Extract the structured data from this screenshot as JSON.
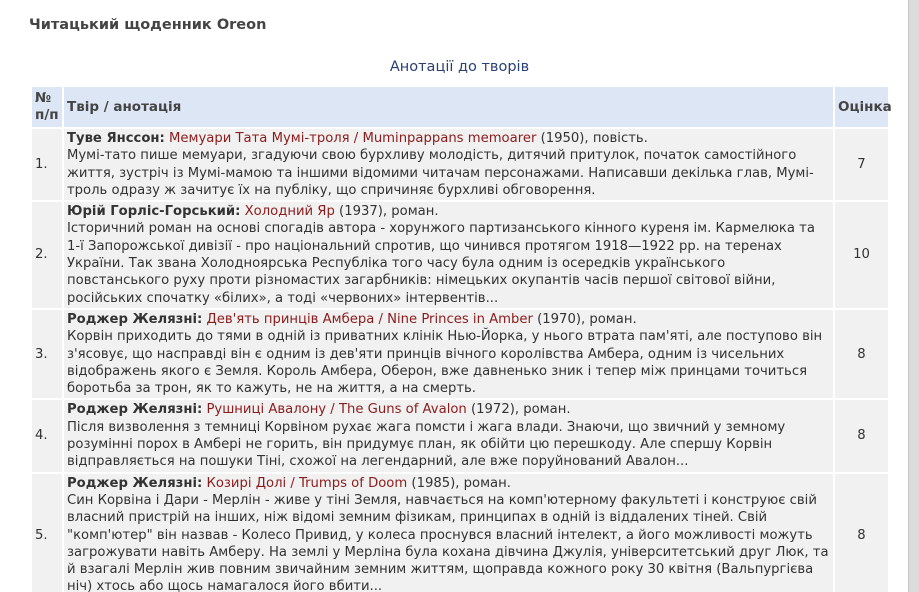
{
  "page_title": "Читацький щоденник Oreon",
  "table_caption": "Анотації до творів",
  "columns": {
    "number": "№ п/п",
    "work": "Твір / анотація",
    "score": "Оцінка"
  },
  "rows": [
    {
      "num": "1.",
      "author": "Туве Янссон:",
      "title": "Мемуари Тата Мумі-троля / Muminpappans memoarer",
      "meta": "(1950), повість.",
      "annotation": "Мумі-тато пише мемуари, згадуючи свою бурхливу молодість, дитячий притулок, початок самостійного життя, зустріч із Мумі-мамою та іншими відомими читачам персонажами. Написавши декілька глав, Мумі-троль одразу ж зачитує їх на публіку, що спричиняє бурхливі обговорення.",
      "score": "7"
    },
    {
      "num": "2.",
      "author": "Юрій Горліс-Горський:",
      "title": "Холодний Яр",
      "meta": "(1937), роман.",
      "annotation": "Історичний роман на основі спогадів автора - хорунжого партизанського кінного куреня ім. Кармелюка та 1-ї Запорожської дивізії - про національний спротив, що чинився протягом 1918—1922 рр. на теренах України. Так звана Холодноярська Республіка того часу була одним із осередків українського повстанського руху проти різномастих загарбників: німецьких окупантів часів першої світової війни, російських спочатку «білих», а тоді «червоних» інтервентів...",
      "score": "10"
    },
    {
      "num": "3.",
      "author": "Роджер Желязні:",
      "title": "Дев'ять принців Амбера / Nine Princes in Amber",
      "meta": "(1970), роман.",
      "annotation": "Корвін приходить до тями в одній із приватних клінік Нью-Йорка, у нього втрата пам'яті, але поступово він з'ясовує, що насправді він є одним із дев'яти принців вічного королівства Амбера, одним із чисельних відображень якого є Земля. Король Амбера, Оберон, вже давненько зник і тепер між принцами точиться боротьба за трон, як то кажуть, не на життя, а на смерть.",
      "score": "8"
    },
    {
      "num": "4.",
      "author": "Роджер Желязні:",
      "title": "Рушниці Авалону / The Guns of Avalon",
      "meta": "(1972), роман.",
      "annotation": "Після визволення з темниці Корвіном рухає жага помсти і жага влади. Знаючи, що звичний у земному розумінні порох в Амбері не горить, він придумує план, як обійти цю перешкоду. Але спершу Корвін відправляється на пошуки Тіні, схожої на легендарний, але вже поруйнований Авалон...",
      "score": "8"
    },
    {
      "num": "5.",
      "author": "Роджер Желязні:",
      "title": "Козирі Долі / Trumps of Doom",
      "meta": "(1985), роман.",
      "annotation": "Син Корвіна і Дари - Мерлін - живе у тіні Земля, навчається на комп'ютерному факультеті і конструює свій власний пристрій на інших, ніж відомі земним фізикам, принципах в одній із віддалених тіней. Свій \"комп'ютер\" він назвав - Колесо Привид, у колеса проснувся власний інтелект, а його можливості можуть загрожувати навіть Амберу. На землі у Мерліна була кохана дівчина Джулія, університетський друг Люк, та й взагалі Мерлін жив повним звичайним земним життям, щоправда кожного року 30 квітня (Вальпургієва ніч) хтось або щось намагалося його вбити...",
      "score": "8"
    }
  ]
}
